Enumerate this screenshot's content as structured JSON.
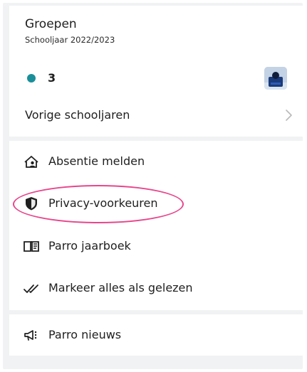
{
  "groups": {
    "title": "Groepen",
    "subtitle": "Schooljaar 2022/2023",
    "items": [
      {
        "name": "3",
        "dot_color": "#1b8f99"
      }
    ],
    "previous_years_label": "Vorige schooljaren"
  },
  "menu": {
    "items": [
      {
        "label": "Absentie melden",
        "icon": "absence-house-icon"
      },
      {
        "label": "Privacy-voorkeuren",
        "icon": "shield-icon"
      },
      {
        "label": "Parro jaarboek",
        "icon": "book-icon"
      },
      {
        "label": "Markeer alles als gelezen",
        "icon": "double-check-icon"
      }
    ]
  },
  "news": {
    "label": "Parro nieuws",
    "icon": "megaphone-icon"
  },
  "highlight_color": "#e8468c"
}
